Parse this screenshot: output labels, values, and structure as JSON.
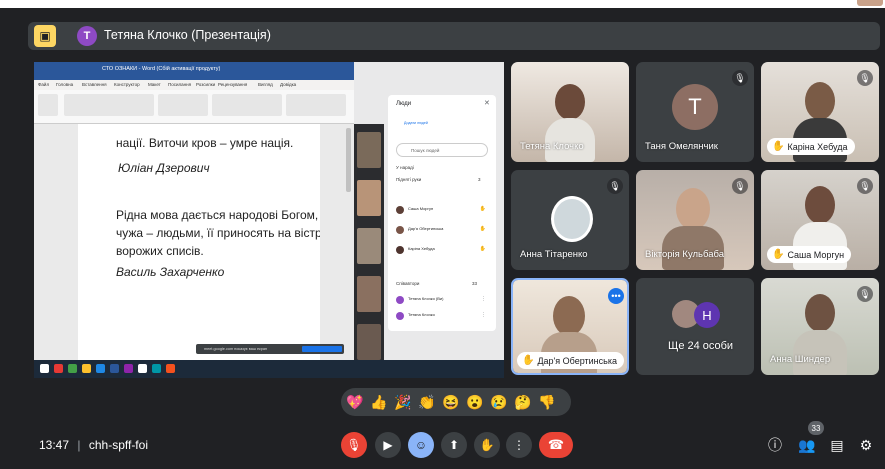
{
  "header": {
    "avatar_letter": "T",
    "presenter_label": "Тетяна Клочко (Презентація)"
  },
  "shared_screen": {
    "word_title": "СТО ОЗНАКИ - Word (Сбій активації продукту)",
    "word_menu": [
      "Файл",
      "Головна",
      "Вставлення",
      "Конструктор",
      "Макет",
      "Посилання",
      "Розсилки",
      "Рецензування",
      "Вигляд",
      "Довідка"
    ],
    "document_lines": [
      {
        "text": "нації. Виточи кров – умре нація.",
        "italic": false
      },
      {
        "text": "Юліан Дзерович",
        "italic": true
      },
      {
        "text": "Рідна мова дається народові Богом,",
        "italic": false
      },
      {
        "text": "чужа – людьми, її приносять на вістрі",
        "italic": false
      },
      {
        "text": "ворожих списів.",
        "italic": false
      },
      {
        "text": "Василь Захарченко",
        "italic": true
      }
    ],
    "people_panel": {
      "title": "Люди",
      "add_people": "Додати людей",
      "search_placeholder": "Пошук людей",
      "in_meeting": "У нараді",
      "raised_hands": "Підняті руки",
      "raised_count": "3",
      "raised_list": [
        "Саша Моргун",
        "Дар'я Обертинська",
        "Каріна Хебуда"
      ],
      "contributors": "Співавтори",
      "contributors_count": "33",
      "contributor_list": [
        "Тетяна Клочко (Ви)",
        "Тетяна Клочко"
      ]
    },
    "notification": "meet.google.com показує ваш екран",
    "notification_button": "Зупинити показ"
  },
  "tiles": [
    {
      "name": "Тетяна Клочко",
      "style": "plain",
      "muted": false
    },
    {
      "name": "Таня Омелянчик",
      "style": "plain",
      "avatar_letter": "T",
      "avatar_color": "#8d6e63",
      "muted": true
    },
    {
      "name": "Каріна Хебуда",
      "style": "pill",
      "muted": true
    },
    {
      "name": "Анна Тітаренко",
      "style": "plain",
      "muted": true
    },
    {
      "name": "Вікторія Кульбаба",
      "style": "plain",
      "muted": true
    },
    {
      "name": "Саша Моргун",
      "style": "pill",
      "muted": true
    },
    {
      "name": "Дар'я Обертинська",
      "style": "pill",
      "muted": false,
      "active": true
    },
    {
      "name": "Ще 24 особи",
      "style": "plain",
      "avatar_letter": "H",
      "avatar_color": "#5e35b1"
    },
    {
      "name": "Анна Шиндер",
      "style": "plain",
      "muted": true
    }
  ],
  "reactions": [
    "💖",
    "👍",
    "🎉",
    "👏",
    "😆",
    "😮",
    "😢",
    "🤔",
    "👎"
  ],
  "bottom": {
    "time": "13:47",
    "separator": "|",
    "meeting_code": "chh-spff-foi",
    "people_count": "33"
  },
  "colors": {
    "accent": "#8ab4f8",
    "danger": "#ea4335",
    "present": "#fdd663",
    "presenter_avatar": "#8e4ac4"
  }
}
